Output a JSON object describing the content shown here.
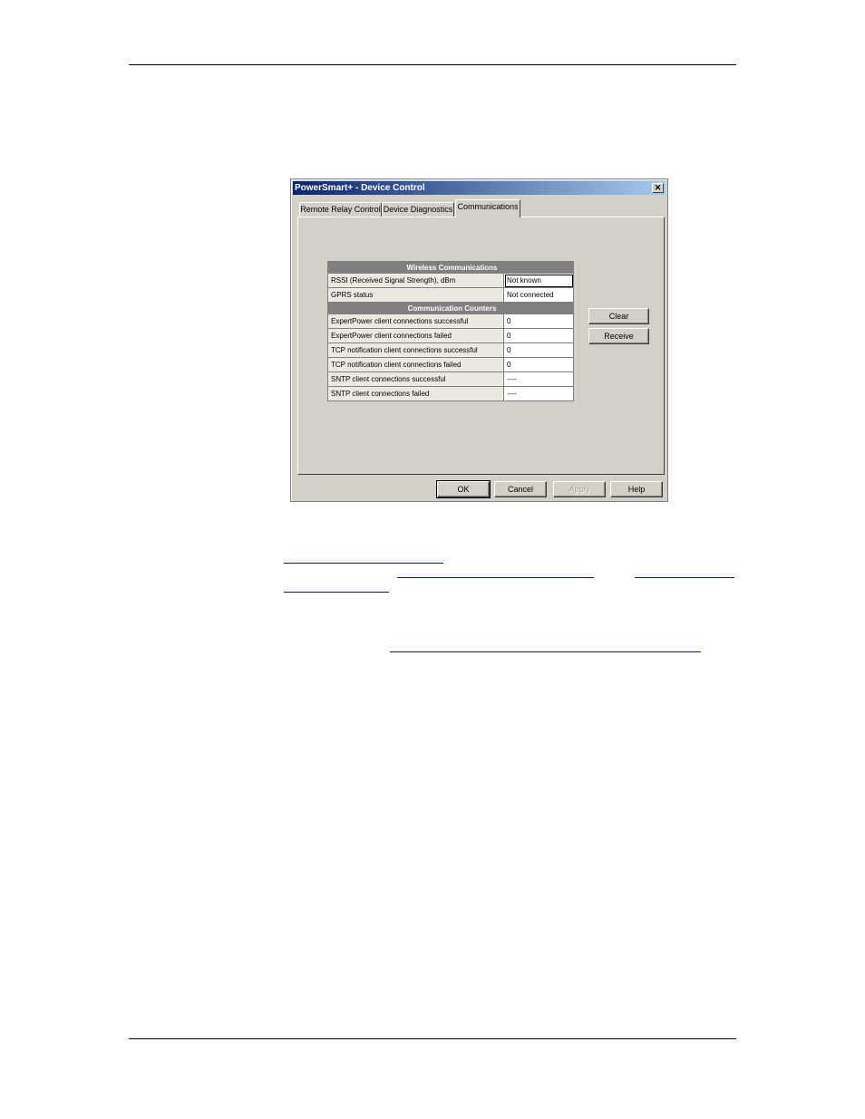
{
  "window": {
    "title": "PowerSmart+ - Device Control",
    "close_glyph": "✕"
  },
  "tabs": [
    {
      "label": "Remote Relay Control",
      "active": false
    },
    {
      "label": "Device Diagnostics",
      "active": false
    },
    {
      "label": "Communications",
      "active": true
    }
  ],
  "wireless": {
    "header": "Wireless Communications",
    "rows": [
      {
        "label": "RSSI (Received Signal Strength), dBm",
        "value": "Not known"
      },
      {
        "label": "GPRS status",
        "value": "Not connected"
      }
    ]
  },
  "counters": {
    "header": "Communication Counters",
    "rows": [
      {
        "label": "ExpertPower client connections successful",
        "value": "0"
      },
      {
        "label": "ExpertPower client connections failed",
        "value": "0"
      },
      {
        "label": "TCP notification client connections successful",
        "value": "0"
      },
      {
        "label": "TCP notification client connections failed",
        "value": "0"
      },
      {
        "label": "SNTP client connections successful",
        "value": "----"
      },
      {
        "label": "SNTP client connections failed",
        "value": "----"
      }
    ]
  },
  "side_buttons": {
    "clear": "Clear",
    "receive": "Receive"
  },
  "footer_buttons": {
    "ok": "OK",
    "cancel": "Cancel",
    "apply": "Apply",
    "help": "Help"
  }
}
